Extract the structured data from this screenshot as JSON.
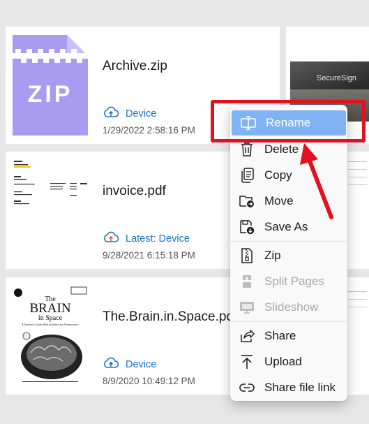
{
  "files": [
    {
      "name": "Archive.zip",
      "location": "Device",
      "date": "1/29/2022 2:58:16 PM",
      "thumb_label": "ZIP"
    },
    {
      "name": "invoice.pdf",
      "location": "Latest: Device",
      "date": "9/28/2021 6:15:18 PM"
    },
    {
      "name": "The.Brain.in.Space.pdf",
      "location": "Device",
      "date": "8/9/2020 10:49:12 PM",
      "cover": {
        "title_line1": "The",
        "title_line2": "BRAIN",
        "title_line3": "in Space",
        "subtitle": "A Teacher's Guide With Activities for Neuroscience"
      }
    }
  ],
  "side_card": {
    "brand_text": "SecureSign"
  },
  "context_menu": {
    "items": [
      {
        "label": "Rename",
        "icon": "rename-icon",
        "highlighted": true
      },
      {
        "label": "Delete",
        "icon": "trash-icon"
      },
      {
        "label": "Copy",
        "icon": "copy-icon"
      },
      {
        "label": "Move",
        "icon": "move-icon"
      },
      {
        "label": "Save As",
        "icon": "save-as-icon"
      },
      {
        "label": "Zip",
        "icon": "zip-icon"
      },
      {
        "label": "Split Pages",
        "icon": "split-pages-icon",
        "disabled": true
      },
      {
        "label": "Slideshow",
        "icon": "slideshow-icon",
        "disabled": true
      },
      {
        "label": "Share",
        "icon": "share-icon"
      },
      {
        "label": "Upload",
        "icon": "upload-icon"
      },
      {
        "label": "Share file link",
        "icon": "link-icon"
      }
    ]
  },
  "colors": {
    "accent": "#1a73c8",
    "highlight": "#7fb3f3",
    "annotation_red": "#e3101e",
    "zip_purple": "#a99cf0"
  }
}
